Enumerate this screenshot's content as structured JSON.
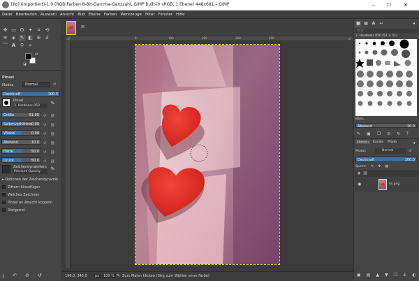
{
  "window": {
    "title": "[Ilo] (importiert)-1.0 (RGB-Farben 8-Bit-Gamma-Ganzzahl, GIMP built-in sRGB, 1 Ebene) 448x681 – GIMP",
    "minimize": "–",
    "maximize": "☐",
    "close": "✕"
  },
  "menu": [
    "Datei",
    "Bearbeiten",
    "Auswahl",
    "Ansicht",
    "Bild",
    "Ebene",
    "Farben",
    "Werkzeuge",
    "Filter",
    "Fenster",
    "Hilfe"
  ],
  "tool_options": {
    "panel_title": "Pinsel",
    "mode_label": "Modus",
    "mode_value": "Normal",
    "opacity_label": "Deckkraft",
    "opacity_value": "100.0",
    "brush_label": "Pinsel",
    "brush_name": "2. Hardness 050",
    "sliders": [
      {
        "label": "Größe",
        "value": "51.00",
        "fill": 0.22
      },
      {
        "label": "Seitenverhältnis",
        "value": "0.00",
        "fill": 0.5
      },
      {
        "label": "Winkel",
        "value": "0.00",
        "fill": 0.5
      },
      {
        "label": "Abstand",
        "value": "10.0",
        "fill": 0.1
      },
      {
        "label": "Härte",
        "value": "50.0",
        "fill": 0.5
      },
      {
        "label": "Druck",
        "value": "50.0",
        "fill": 0.5
      }
    ],
    "dynamics_label": "Zeichendynamiken",
    "dynamics_value": "Pressure Opacity",
    "options": [
      "Optionen der Zeichendynamik",
      "Zittern hinzufügen",
      "Weiches Zeichnen",
      "Pinsel an Ansicht koppeln",
      "Steigernd"
    ]
  },
  "canvas": {
    "ruler_ticks": [
      "0",
      "100",
      "200",
      "300",
      "400"
    ]
  },
  "status": {
    "coords": "196.0, 345.0",
    "unit": "px",
    "zoom": "100 %",
    "message": "Zum Malen klicken (Strg zum Wählen einer Farbe)"
  },
  "brushes_dock": {
    "filter_placeholder": "Filter",
    "selected_brush": "2. Hardness 050 (51 × 51)",
    "preset_name": "Basic,",
    "spacing_label": "Abstand",
    "spacing_value": "10.0"
  },
  "layers_dock": {
    "tabs": [
      "Ebenen",
      "Kanäle",
      "Pfade"
    ],
    "mode_label": "Modus",
    "mode_value": "Normal",
    "opacity_label": "Deckkraft",
    "opacity_value": "100.0",
    "lock_label": "Sperre:",
    "layer_name": "Ilo.png"
  },
  "colors": {
    "fg": "#000000",
    "bg": "#ffffff",
    "accent": "#3f6fa0",
    "heart": "#e0302a"
  }
}
